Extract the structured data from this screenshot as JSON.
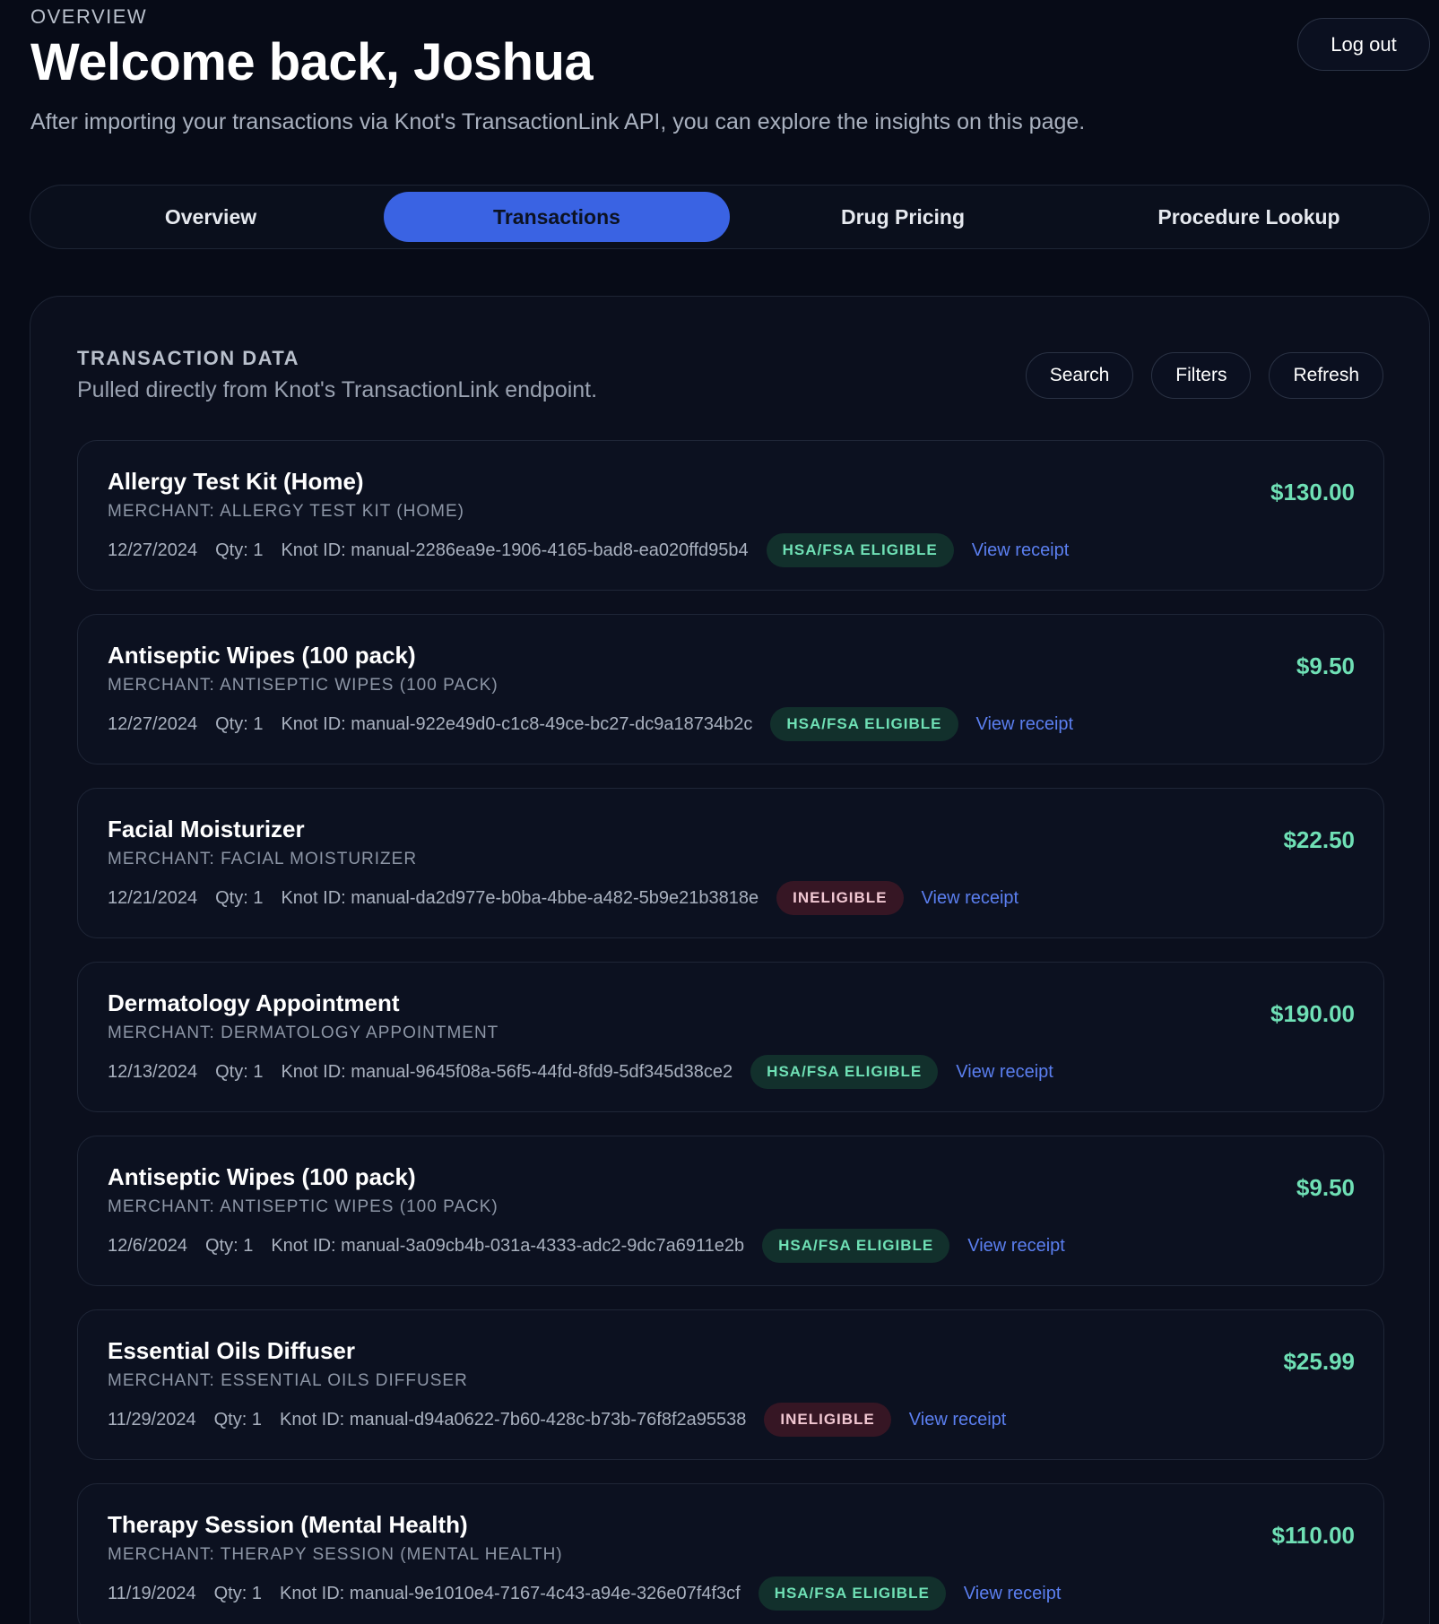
{
  "header": {
    "eyebrow": "OVERVIEW",
    "title": "Welcome back, Joshua",
    "subtitle": "After importing your transactions via Knot's TransactionLink API, you can explore the insights on this page.",
    "logout_label": "Log out"
  },
  "tabs": [
    {
      "label": "Overview",
      "active": false
    },
    {
      "label": "Transactions",
      "active": true
    },
    {
      "label": "Drug Pricing",
      "active": false
    },
    {
      "label": "Procedure Lookup",
      "active": false
    }
  ],
  "panel": {
    "label": "TRANSACTION DATA",
    "subtitle": "Pulled directly from Knot's TransactionLink endpoint.",
    "actions": {
      "search": "Search",
      "filters": "Filters",
      "refresh": "Refresh"
    }
  },
  "transactions": [
    {
      "name": "Allergy Test Kit (Home)",
      "merchant": "MERCHANT: ALLERGY TEST KIT (HOME)",
      "date": "12/27/2024",
      "qty": "Qty: 1",
      "knot_id": "Knot ID: manual-2286ea9e-1906-4165-bad8-ea020ffd95b4",
      "status": "HSA/FSA ELIGIBLE",
      "eligible": true,
      "receipt": "View receipt",
      "amount": "$130.00"
    },
    {
      "name": "Antiseptic Wipes (100 pack)",
      "merchant": "MERCHANT: ANTISEPTIC WIPES (100 PACK)",
      "date": "12/27/2024",
      "qty": "Qty: 1",
      "knot_id": "Knot ID: manual-922e49d0-c1c8-49ce-bc27-dc9a18734b2c",
      "status": "HSA/FSA ELIGIBLE",
      "eligible": true,
      "receipt": "View receipt",
      "amount": "$9.50"
    },
    {
      "name": "Facial Moisturizer",
      "merchant": "MERCHANT: FACIAL MOISTURIZER",
      "date": "12/21/2024",
      "qty": "Qty: 1",
      "knot_id": "Knot ID: manual-da2d977e-b0ba-4bbe-a482-5b9e21b3818e",
      "status": "INELIGIBLE",
      "eligible": false,
      "receipt": "View receipt",
      "amount": "$22.50"
    },
    {
      "name": "Dermatology Appointment",
      "merchant": "MERCHANT: DERMATOLOGY APPOINTMENT",
      "date": "12/13/2024",
      "qty": "Qty: 1",
      "knot_id": "Knot ID: manual-9645f08a-56f5-44fd-8fd9-5df345d38ce2",
      "status": "HSA/FSA ELIGIBLE",
      "eligible": true,
      "receipt": "View receipt",
      "amount": "$190.00"
    },
    {
      "name": "Antiseptic Wipes (100 pack)",
      "merchant": "MERCHANT: ANTISEPTIC WIPES (100 PACK)",
      "date": "12/6/2024",
      "qty": "Qty: 1",
      "knot_id": "Knot ID: manual-3a09cb4b-031a-4333-adc2-9dc7a6911e2b",
      "status": "HSA/FSA ELIGIBLE",
      "eligible": true,
      "receipt": "View receipt",
      "amount": "$9.50"
    },
    {
      "name": "Essential Oils Diffuser",
      "merchant": "MERCHANT: ESSENTIAL OILS DIFFUSER",
      "date": "11/29/2024",
      "qty": "Qty: 1",
      "knot_id": "Knot ID: manual-d94a0622-7b60-428c-b73b-76f8f2a95538",
      "status": "INELIGIBLE",
      "eligible": false,
      "receipt": "View receipt",
      "amount": "$25.99"
    },
    {
      "name": "Therapy Session (Mental Health)",
      "merchant": "MERCHANT: THERAPY SESSION (MENTAL HEALTH)",
      "date": "11/19/2024",
      "qty": "Qty: 1",
      "knot_id": "Knot ID: manual-9e1010e4-7167-4c43-a94e-326e07f4f3cf",
      "status": "HSA/FSA ELIGIBLE",
      "eligible": true,
      "receipt": "View receipt",
      "amount": "$110.00"
    }
  ]
}
